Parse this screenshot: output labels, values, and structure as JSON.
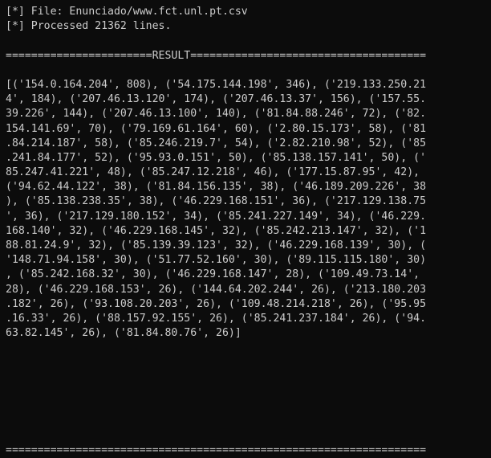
{
  "terminal": {
    "header_lines": [
      "[*] File: Enunciado/www.fct.unl.pt.csv",
      "[*] Processed 21362 lines."
    ],
    "result_banner": "=======================RESULT=====================================",
    "result_lines": [
      "[('154.0.164.204', 808), ('54.175.144.198', 346), ('219.133.250.21",
      "4', 184), ('207.46.13.120', 174), ('207.46.13.37', 156), ('157.55.",
      "39.226', 144), ('207.46.13.100', 140), ('81.84.88.246', 72), ('82.",
      "154.141.69', 70), ('79.169.61.164', 60), ('2.80.15.173', 58), ('81",
      ".84.214.187', 58), ('85.246.219.7', 54), ('2.82.210.98', 52), ('85",
      ".241.84.177', 52), ('95.93.0.151', 50), ('85.138.157.141', 50), ('",
      "85.247.41.221', 48), ('85.247.12.218', 46), ('177.15.87.95', 42),",
      "('94.62.44.122', 38), ('81.84.156.135', 38), ('46.189.209.226', 38",
      "), ('85.138.238.35', 38), ('46.229.168.151', 36), ('217.129.138.75",
      "', 36), ('217.129.180.152', 34), ('85.241.227.149', 34), ('46.229.",
      "168.140', 32), ('46.229.168.145', 32), ('85.242.213.147', 32), ('1",
      "88.81.24.9', 32), ('85.139.39.123', 32), ('46.229.168.139', 30), (",
      "'148.71.94.158', 30), ('51.77.52.160', 30), ('89.115.115.180', 30)",
      ", ('85.242.168.32', 30), ('46.229.168.147', 28), ('109.49.73.14',",
      "28), ('46.229.168.153', 26), ('144.64.202.244', 26), ('213.180.203",
      ".182', 26), ('93.108.20.203', 26), ('109.48.214.218', 26), ('95.95",
      ".16.33', 26), ('88.157.92.155', 26), ('85.241.237.184', 26), ('94.",
      "63.82.145', 26), ('81.84.80.76', 26)]"
    ],
    "footer_banner": "=================================================================="
  }
}
